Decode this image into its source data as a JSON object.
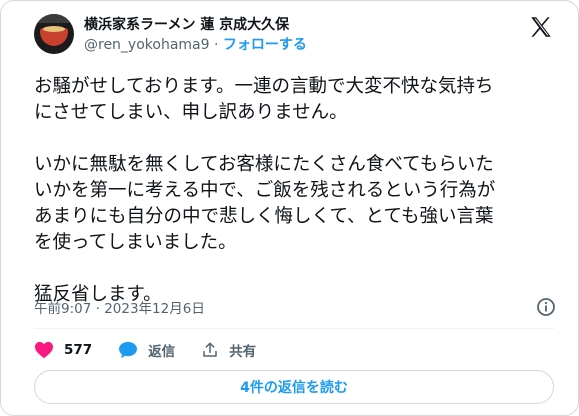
{
  "author": {
    "display_name": "横浜家系ラーメン 蓮 京成大久保",
    "handle": "@ren_yokohama9",
    "separator": "·",
    "follow_label": "フォローする"
  },
  "tweet": {
    "text": "お騒がせしております。一連の言動で大変不快な気持ち\nにさせてしまい、申し訳ありません。\n\nいかに無駄を無くしてお客様にたくさん食べてもらいた\nいかを第一に考える中で、ご飯を残されるという行為が\nあまりにも自分の中で悲しく悔しくて、とても強い言葉\nを使ってしまいました。\n\n猛反省します。",
    "timestamp": "午前9:07 · 2023年12月6日"
  },
  "actions": {
    "like_count": "577",
    "reply_label": "返信",
    "share_label": "共有"
  },
  "replies_button_label": "4件の返信を読む",
  "colors": {
    "accent": "#1d9bf0",
    "like": "#f91880",
    "text": "#0f1419",
    "secondary": "#536471"
  }
}
